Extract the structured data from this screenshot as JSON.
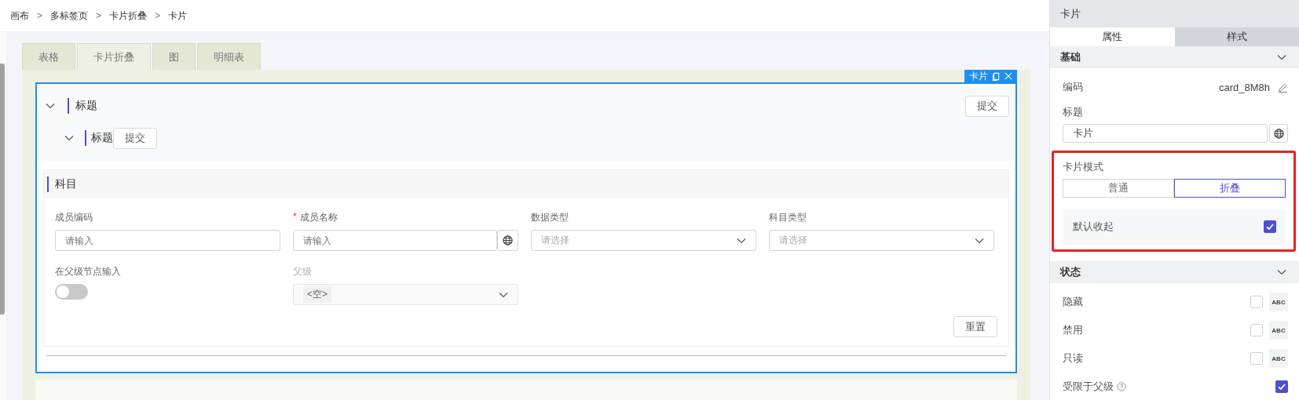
{
  "breadcrumb": {
    "separator": ">",
    "items": [
      "画布",
      "多标签页",
      "卡片折叠",
      "卡片"
    ]
  },
  "tabs": [
    {
      "label": "表格",
      "selected": false
    },
    {
      "label": "卡片折叠",
      "selected": true
    },
    {
      "label": "图",
      "selected": false
    },
    {
      "label": "明细表",
      "selected": false
    }
  ],
  "selected_card": {
    "label": "卡片"
  },
  "card": {
    "title": "标题",
    "expanded": true,
    "button": "提交",
    "sub": {
      "title": "标题",
      "expanded": true,
      "button": "提交"
    }
  },
  "section": {
    "title": "科目",
    "required_mark": "*",
    "reset_button": "重置",
    "fields": [
      {
        "kind": "input",
        "label": "成员编码",
        "required": false,
        "placeholder": "请输入",
        "globe": false,
        "disabled": false
      },
      {
        "kind": "input",
        "label": "成员名称",
        "required": true,
        "placeholder": "请输入",
        "globe": true,
        "disabled": false
      },
      {
        "kind": "select",
        "label": "数据类型",
        "required": false,
        "placeholder": "请选择",
        "disabled": false
      },
      {
        "kind": "select",
        "label": "科目类型",
        "required": false,
        "placeholder": "请选择",
        "disabled": false
      },
      {
        "kind": "toggle",
        "label": "在父级节点输入",
        "required": false,
        "on": false,
        "disabled": false
      },
      {
        "kind": "select",
        "label": "父级",
        "required": false,
        "value": "<空>",
        "disabled": true
      }
    ]
  },
  "panel": {
    "title": "卡片",
    "tabs": [
      {
        "label": "属性",
        "selected": true
      },
      {
        "label": "样式",
        "selected": false
      }
    ],
    "sections": [
      {
        "title": "基础",
        "expanded": true,
        "rows": [
          {
            "kind": "value",
            "label": "编码",
            "value": "card_8M8h"
          },
          {
            "kind": "input",
            "label": "标题",
            "value": "卡片"
          }
        ],
        "highlighted_rows": [
          {
            "kind": "segmented",
            "label": "卡片模式",
            "options": [
              {
                "label": "普通",
                "selected": false
              },
              {
                "label": "折叠",
                "selected": true
              }
            ]
          },
          {
            "kind": "check",
            "label": "默认收起",
            "checked": true,
            "shaded": true
          }
        ]
      },
      {
        "title": "状态",
        "expanded": true,
        "rows": [
          {
            "kind": "check",
            "label": "隐藏",
            "checked": false,
            "abc": "ABC"
          },
          {
            "kind": "check",
            "label": "禁用",
            "checked": false,
            "abc": "ABC"
          },
          {
            "kind": "check",
            "label": "只读",
            "checked": false,
            "abc": "ABC"
          },
          {
            "kind": "check",
            "label": "受限于父级",
            "checked": true,
            "help": true
          }
        ]
      }
    ]
  }
}
